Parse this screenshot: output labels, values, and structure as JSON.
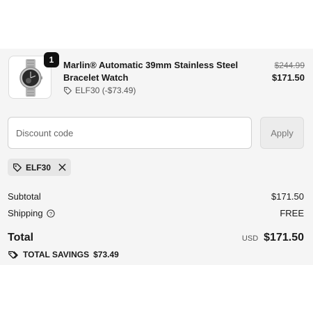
{
  "product": {
    "name": "Marlin® Automatic 39mm Stainless Steel Bracelet Watch",
    "quantity": "1",
    "discount_applied": "ELF30 (-$73.49)",
    "original_price": "$244.99",
    "price": "$171.50",
    "image_icon": "watch-icon"
  },
  "discount": {
    "placeholder": "Discount code",
    "value": "",
    "apply_label": "Apply",
    "applied_code": "ELF30"
  },
  "summary": {
    "subtotal_label": "Subtotal",
    "subtotal_value": "$171.50",
    "shipping_label": "Shipping",
    "shipping_value": "FREE",
    "total_label": "Total",
    "currency": "USD",
    "total_value": "$171.50",
    "savings_label": "TOTAL SAVINGS",
    "savings_value": "$73.49"
  },
  "colors": {
    "panel_background": "#f5f5f5",
    "text": "#1a1a1a",
    "badge": "#111111",
    "chip": "#e6e6e6",
    "button_disabled": "#ececec"
  }
}
